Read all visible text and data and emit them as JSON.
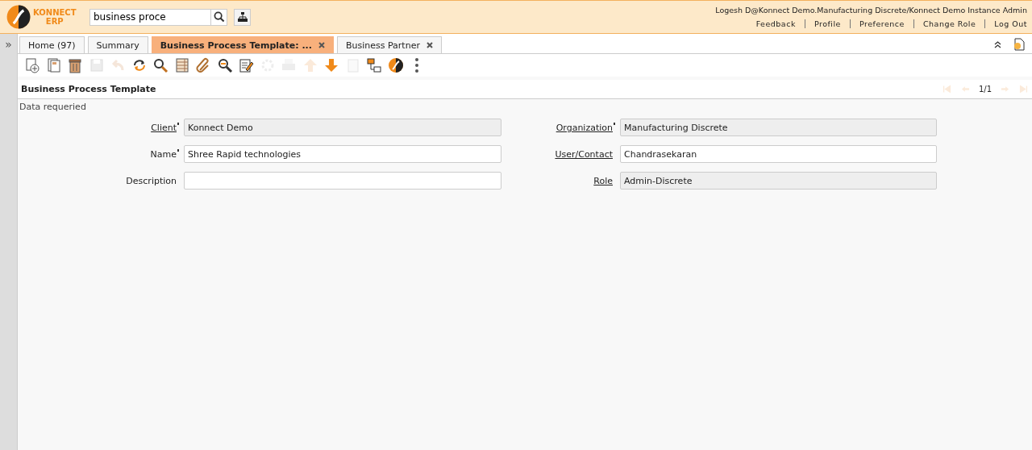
{
  "header": {
    "logo": {
      "line_1": "KONNECT",
      "line_2": "ERP"
    },
    "search": {
      "value": "business proce"
    },
    "user": "Logesh D@Konnect Demo.Manufacturing Discrete/Konnect Demo Instance Admin",
    "links": [
      "Feedback",
      "Profile",
      "Preference",
      "Change Role",
      "Log Out"
    ]
  },
  "side_toggle": "»",
  "tabs": [
    {
      "label": "Home (97)",
      "selected": false,
      "closable": false
    },
    {
      "label": "Summary",
      "selected": false,
      "closable": false
    },
    {
      "label": "Business Process Template: ...",
      "selected": true,
      "closable": true
    },
    {
      "label": "Business Partner",
      "selected": false,
      "closable": true
    }
  ],
  "toolbar": [
    {
      "kind": "new",
      "disabled": false
    },
    {
      "kind": "copy",
      "disabled": false
    },
    {
      "kind": "delete",
      "disabled": false
    },
    {
      "kind": "save",
      "disabled": true
    },
    {
      "kind": "undo",
      "disabled": true
    },
    {
      "kind": "refresh",
      "disabled": false
    },
    {
      "kind": "find",
      "disabled": false
    },
    {
      "kind": "grid",
      "disabled": false
    },
    {
      "kind": "attach",
      "disabled": false
    },
    {
      "kind": "zoom",
      "disabled": false
    },
    {
      "kind": "note",
      "disabled": false
    },
    {
      "kind": "process",
      "disabled": true
    },
    {
      "kind": "print",
      "disabled": true
    },
    {
      "kind": "up",
      "disabled": true
    },
    {
      "kind": "down",
      "disabled": false
    },
    {
      "kind": "report",
      "disabled": true
    },
    {
      "kind": "workflow",
      "disabled": false
    },
    {
      "kind": "logo",
      "disabled": false
    },
    {
      "kind": "more",
      "disabled": false
    }
  ],
  "window_title": "Business Process Template",
  "navigation": {
    "position": "1/1",
    "buttons": [
      {
        "kind": "first",
        "disabled": true
      },
      {
        "kind": "prev",
        "disabled": true
      },
      {
        "kind": "next",
        "disabled": true
      },
      {
        "kind": "last",
        "disabled": true
      }
    ]
  },
  "status": "Data requeried",
  "fields": [
    {
      "label": "Client",
      "value": "Konnect Demo",
      "mandatory": true,
      "link": true,
      "readonly": true
    },
    {
      "label": "Organization",
      "value": "Manufacturing Discrete",
      "mandatory": true,
      "link": true,
      "readonly": true
    },
    {
      "label": "Name",
      "value": "Shree Rapid technologies",
      "mandatory": true,
      "link": false,
      "readonly": false
    },
    {
      "label": "User/Contact",
      "value": "Chandrasekaran",
      "mandatory": false,
      "link": true,
      "readonly": false
    },
    {
      "label": "Description",
      "mandatory": false,
      "link": false,
      "readonly": false
    },
    {
      "label": "Role",
      "value": "Admin-Discrete",
      "mandatory": false,
      "link": true,
      "readonly": true
    }
  ]
}
